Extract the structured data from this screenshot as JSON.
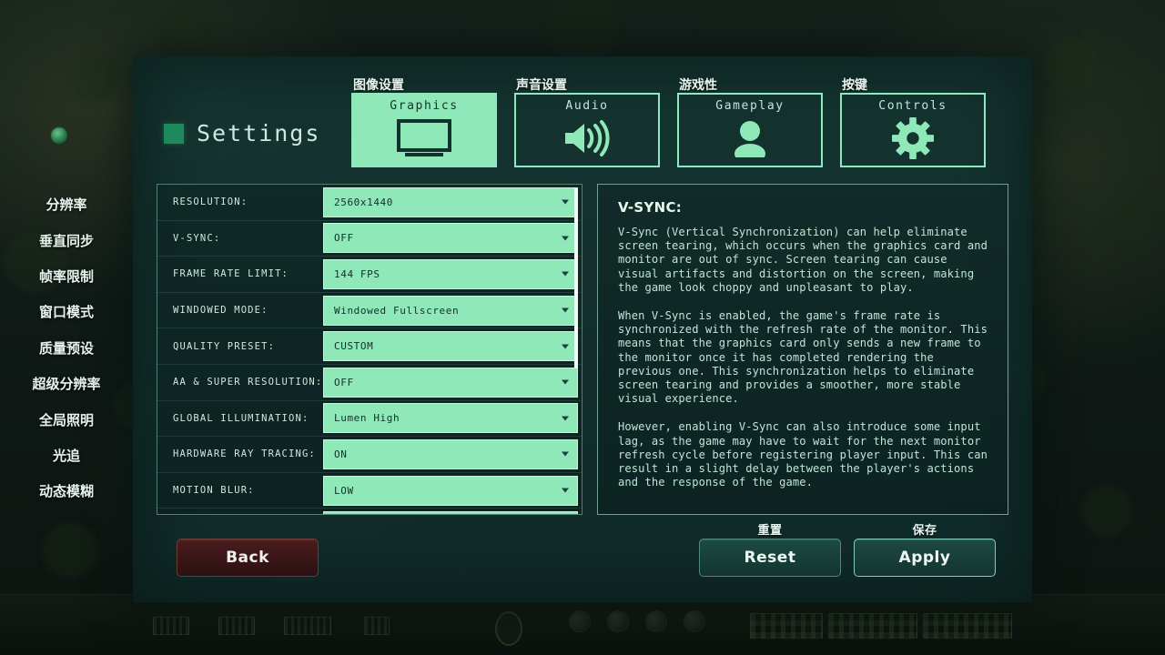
{
  "window": {
    "title": "Settings",
    "title_icon": "square-icon"
  },
  "tabs": [
    {
      "label": "Graphics",
      "cn": "图像设置",
      "icon": "monitor-icon",
      "active": true
    },
    {
      "label": "Audio",
      "cn": "声音设置",
      "icon": "speaker-icon",
      "active": false
    },
    {
      "label": "Gameplay",
      "cn": "游戏性",
      "icon": "person-icon",
      "active": false
    },
    {
      "label": "Controls",
      "cn": "按键",
      "icon": "gear-icon",
      "active": false
    }
  ],
  "settings": {
    "rows": [
      {
        "label": "RESOLUTION:",
        "value": "2560x1440",
        "cn": "分辨率"
      },
      {
        "label": "V-SYNC:",
        "value": "OFF",
        "cn": "垂直同步"
      },
      {
        "label": "FRAME RATE LIMIT:",
        "value": "144 FPS",
        "cn": "帧率限制"
      },
      {
        "label": "WINDOWED MODE:",
        "value": "Windowed Fullscreen",
        "cn": "窗口模式"
      },
      {
        "label": "QUALITY PRESET:",
        "value": "CUSTOM",
        "cn": "质量预设"
      },
      {
        "label": "AA & SUPER RESOLUTION:",
        "value": "OFF",
        "cn": "超级分辨率"
      },
      {
        "label": "GLOBAL ILLUMINATION:",
        "value": "Lumen High",
        "cn": "全局照明"
      },
      {
        "label": "HARDWARE RAY TRACING:",
        "value": "ON",
        "cn": "光追"
      },
      {
        "label": "MOTION BLUR:",
        "value": "LOW",
        "cn": "动态模糊"
      }
    ]
  },
  "description": {
    "title": "V-SYNC:",
    "paragraphs": [
      "V-Sync (Vertical Synchronization) can help eliminate screen tearing, which occurs when the graphics card and monitor are out of sync. Screen tearing can cause visual artifacts and distortion on the screen, making the game look choppy and unpleasant to play.",
      "When V-Sync is enabled, the game's frame rate is synchronized with the refresh rate of the monitor. This means that the graphics card only sends a new frame to the monitor once it has completed rendering the previous one. This synchronization helps to eliminate screen tearing and provides a smoother, more stable visual experience.",
      "However, enabling V-Sync can also introduce some input lag, as the game may have to wait for the next monitor refresh cycle before registering player input. This can result in a slight delay between the player's actions and the response of the game."
    ]
  },
  "footer": {
    "back": {
      "label": "Back",
      "cn": ""
    },
    "reset": {
      "label": "Reset",
      "cn": "重置"
    },
    "apply": {
      "label": "Apply",
      "cn": "保存"
    }
  },
  "colors": {
    "accent_mint": "#8fe8b8",
    "panel_teal": "#153633",
    "text_light": "#cfe9dd",
    "back_red": "#4a1c1e"
  }
}
